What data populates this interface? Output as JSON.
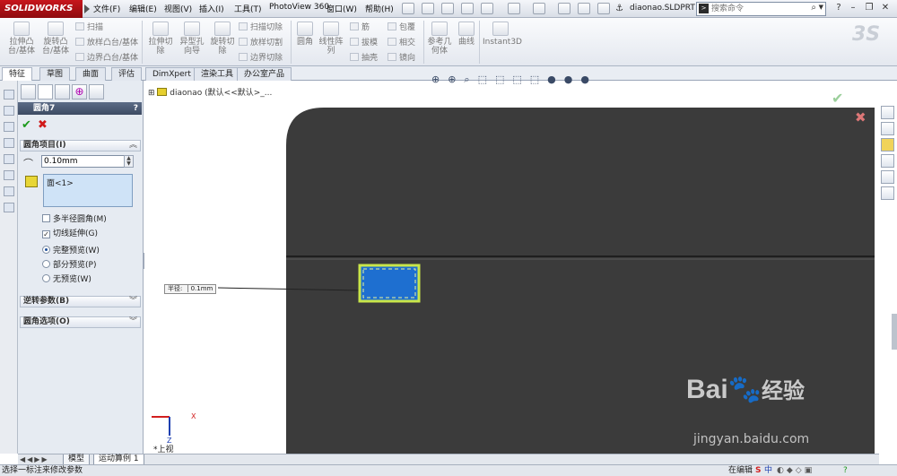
{
  "app": {
    "logo_text": "SOLIDWORKS",
    "doc_title": "diaonao.SLDPRT *"
  },
  "menu": [
    "文件(F)",
    "编辑(E)",
    "视图(V)",
    "插入(I)",
    "工具(T)",
    "PhotoView 360",
    "窗口(W)",
    "帮助(H)"
  ],
  "search": {
    "placeholder": "搜索命令"
  },
  "ribbon": {
    "big": [
      {
        "label": "拉伸凸台/基体"
      },
      {
        "label": "旋转凸台/基体"
      },
      {
        "label": "拉伸切除"
      },
      {
        "label": "异型孔向导"
      },
      {
        "label": "旋转切除"
      },
      {
        "label": "圆角"
      },
      {
        "label": "线性阵列"
      },
      {
        "label": "参考几何体"
      },
      {
        "label": "曲线"
      },
      {
        "label": "Instant3D"
      }
    ],
    "small": [
      {
        "label": "扫描"
      },
      {
        "label": "放样凸台/基体"
      },
      {
        "label": "边界凸台/基体"
      },
      {
        "label": "扫描切除"
      },
      {
        "label": "放样切割"
      },
      {
        "label": "边界切除"
      },
      {
        "label": "筋"
      },
      {
        "label": "拔模"
      },
      {
        "label": "抽壳"
      },
      {
        "label": "包覆"
      },
      {
        "label": "相交"
      },
      {
        "label": "镜向"
      }
    ]
  },
  "tabs": [
    "特征",
    "草图",
    "曲面",
    "评估",
    "DimXpert",
    "渲染工具",
    "办公室产品"
  ],
  "active_tab": "特征",
  "pm": {
    "title": "圆角7",
    "help": "?",
    "sections": {
      "items": "圆角项目(I)",
      "reverse": "逆转参数(B)",
      "options": "圆角选项(O)"
    },
    "radius_value": "0.10mm",
    "face_item": "面<1>",
    "opt_multi_radius": "多半径圆角(M)",
    "opt_tangent": "切线延伸(G)",
    "radio_full": "完整预览(W)",
    "radio_partial": "部分预览(P)",
    "radio_none": "无预览(W)"
  },
  "tree": {
    "root": "diaonao",
    "config": "(默认<<默认>_..."
  },
  "viewport": {
    "radius_label": "半径:",
    "radius_value": "0.1mm",
    "axis_x": "X",
    "axis_z": "Z",
    "view_name": "*上视"
  },
  "bottom_tabs": [
    "模型",
    "运动算例 1"
  ],
  "status": {
    "text": "选择一标注来修改参数",
    "right": "在编辑"
  },
  "watermark": {
    "line1": "Bai",
    "line2": "经验",
    "url": "jingyan.baidu.com"
  },
  "colors": {
    "model_body": "#3b3b3b",
    "selection": "#1e6fd0",
    "highlight": "#c8e64a",
    "title_red": "#c7161c"
  }
}
